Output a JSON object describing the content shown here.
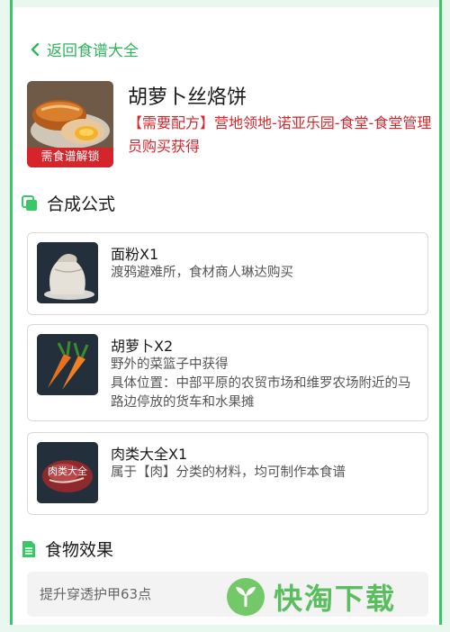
{
  "nav": {
    "back_label": "返回食谱大全"
  },
  "recipe": {
    "title": "胡萝卜丝烙饼",
    "badge": "需食谱解锁",
    "requirement": "【需要配方】营地领地-诺亚乐园-食堂-食堂管理员购买获得"
  },
  "formula": {
    "heading": "合成公式",
    "items": [
      {
        "name": "面粉X1",
        "desc": "渡鸦避难所，食材商人琳达购买",
        "icon": "flour-sack-icon"
      },
      {
        "name": "胡萝卜X2",
        "desc": "野外的菜篮子中获得\n具体位置：中部平原的农贸市场和维罗农场附近的马路边停放的货车和水果摊",
        "icon": "carrot-icon"
      },
      {
        "name": "肉类大全X1",
        "desc": "属于【肉】分类的材料，均可制作本食谱",
        "icon": "meat-icon",
        "thumb_label": "肉类大全"
      }
    ]
  },
  "effect": {
    "heading": "食物效果",
    "text": "提升穿透护甲63点"
  },
  "watermark": {
    "text": "快淘下载"
  },
  "colors": {
    "accent": "#39c867",
    "requirement": "#d8262c"
  }
}
